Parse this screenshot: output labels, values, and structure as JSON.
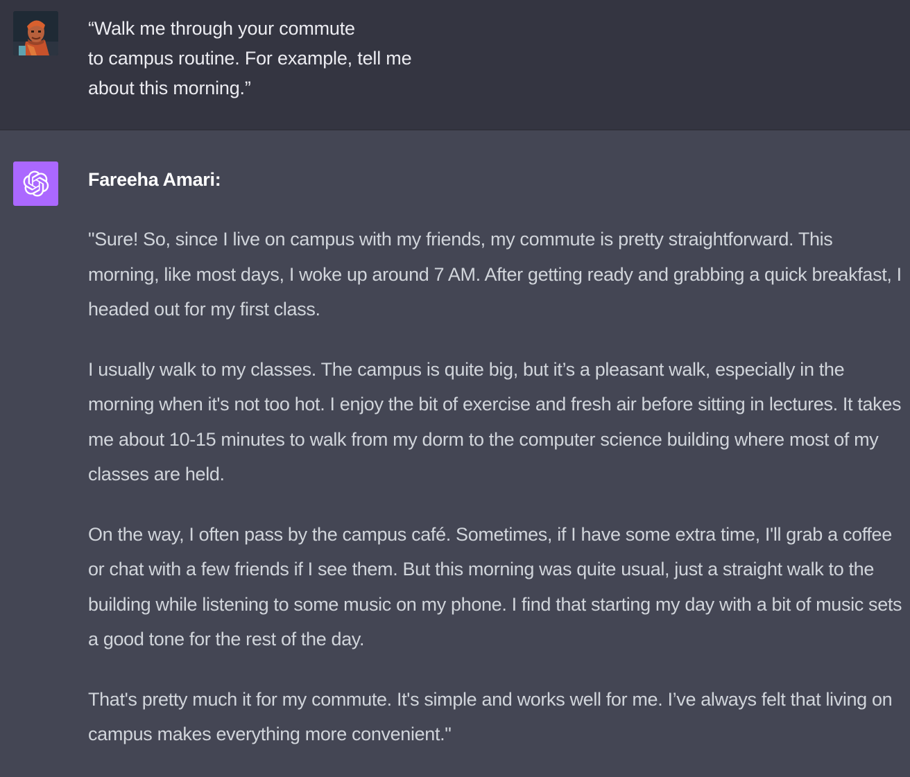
{
  "user_message": {
    "text": "“Walk me through your commute\nto campus routine. For example, tell me\nabout this morning.”"
  },
  "assistant_message": {
    "speaker": "Fareeha Amari:",
    "paragraphs": [
      "\"Sure! So, since I live on campus with my friends, my commute is pretty straightforward. This morning, like most days, I woke up around 7 AM. After getting ready and grabbing a quick breakfast, I headed out for my first class.",
      "I usually walk to my classes. The campus is quite big, but it’s a pleasant walk, especially in the morning when it's not too hot. I enjoy the bit of exercise and fresh air before sitting in lectures. It takes me about 10-15 minutes to walk from my dorm to the computer science building where most of my classes are held.",
      "On the way, I often pass by the campus café. Sometimes, if I have some extra time, I'll grab a coffee or chat with a few friends if I see them. But this morning was quite usual, just a straight walk to the building while listening to some music on my phone. I find that starting my day with a bit of music sets a good tone for the rest of the day.",
      "That's pretty much it for my commute. It's simple and works well for me. I’ve always felt that living on campus makes everything more convenient.\""
    ]
  },
  "icons": {
    "user_avatar": "user-avatar-icon",
    "assistant_avatar": "openai-logo-icon"
  },
  "colors": {
    "user_bg": "#343541",
    "assistant_bg": "#444654",
    "assistant_avatar_bg": "#ab68ff"
  }
}
